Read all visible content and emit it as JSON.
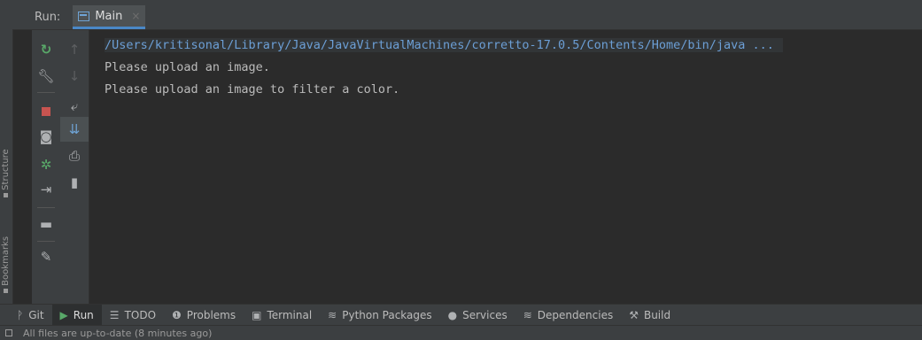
{
  "header": {
    "run_label": "Run:",
    "tab": {
      "label": "Main",
      "close": "×"
    }
  },
  "left_stripe": {
    "structure": "Structure",
    "bookmarks": "Bookmarks"
  },
  "console": {
    "lines": [
      "/Users/kritisonal/Library/Java/JavaVirtualMachines/corretto-17.0.5/Contents/Home/bin/java ...",
      "Please upload an image.",
      "Please upload an image to filter a color."
    ]
  },
  "bottom_tabs": [
    {
      "label": "Git",
      "icon": "git-branch-icon"
    },
    {
      "label": "Run",
      "icon": "run-icon",
      "active": true
    },
    {
      "label": "TODO",
      "icon": "list-icon"
    },
    {
      "label": "Problems",
      "icon": "problems-icon"
    },
    {
      "label": "Terminal",
      "icon": "terminal-icon"
    },
    {
      "label": "Python Packages",
      "icon": "python-packages-icon"
    },
    {
      "label": "Services",
      "icon": "services-icon"
    },
    {
      "label": "Dependencies",
      "icon": "dependencies-icon"
    },
    {
      "label": "Build",
      "icon": "hammer-icon"
    }
  ],
  "status_bar": {
    "text": "All files are up-to-date (8 minutes ago)"
  },
  "colors": {
    "accent": "#4a88c7",
    "path_link": "#6c9fd6",
    "stop_red": "#c75450",
    "rerun_green": "#59a869"
  }
}
